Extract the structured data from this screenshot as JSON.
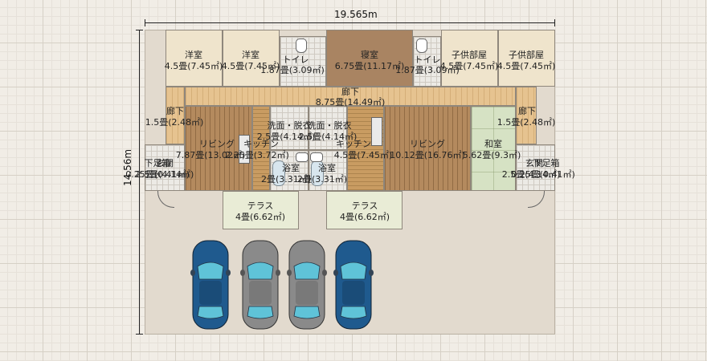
{
  "dimensions": {
    "width_label": "19.565m",
    "height_label": "14.56m"
  },
  "rooms": {
    "western1": {
      "name": "洋室",
      "size": "4.5畳(7.45㎡)"
    },
    "western2": {
      "name": "洋室",
      "size": "4.5畳(7.45㎡)"
    },
    "toilet1": {
      "name": "トイレ",
      "size": "1.87畳(3.09㎡)"
    },
    "bedroom": {
      "name": "寝室",
      "size": "6.75畳(11.17㎡)"
    },
    "toilet2": {
      "name": "トイレ",
      "size": "1.87畳(3.09㎡)"
    },
    "kids1": {
      "name": "子供部屋",
      "size": "4.5畳(7.45㎡)"
    },
    "kids2": {
      "name": "子供部屋",
      "size": "4.5畳(7.45㎡)"
    },
    "corridor_main": {
      "name": "廊下",
      "size": "8.75畳(14.49㎡)"
    },
    "corridor_left": {
      "name": "廊下",
      "size": "1.5畳(2.48㎡)"
    },
    "corridor_right": {
      "name": "廊下",
      "size": "1.5畳(2.48㎡)"
    },
    "wash1": {
      "name": "洗面・脱衣",
      "size": "2.5畳(4.14㎡)"
    },
    "wash2": {
      "name": "洗面・脱衣",
      "size": "2.5畳(4.14㎡)"
    },
    "living1": {
      "name": "リビング",
      "size": "7.87畳(13.02㎡)"
    },
    "kitchen1": {
      "name": "キッチン",
      "size": "2.25畳(3.72㎡)"
    },
    "kitchen2": {
      "name": "キッチン",
      "size": "4.5畳(7.45㎡)"
    },
    "living2": {
      "name": "リビング",
      "size": "10.12畳(16.76㎡)"
    },
    "washitsu": {
      "name": "和室",
      "size": "5.62畳(9.3㎡)"
    },
    "bath1": {
      "name": "浴室",
      "size": "2畳(3.31㎡)"
    },
    "bath2": {
      "name": "浴室",
      "size": "2畳(3.31㎡)"
    },
    "shoebox_left": {
      "name": "下足箱",
      "size": "0.25畳(0.41㎡)"
    },
    "entrance_left": {
      "name": "玄関",
      "size": "2.5畳(4.14㎡)"
    },
    "entrance_right": {
      "name": "玄関",
      "size": "2.5畳(4.14㎡)"
    },
    "shoebox_right": {
      "name": "下足箱",
      "size": "0.25畳(0.41㎡)"
    },
    "terrace1": {
      "name": "テラス",
      "size": "4畳(6.62㎡)"
    },
    "terrace2": {
      "name": "テラス",
      "size": "4畳(6.62㎡)"
    }
  },
  "cars": [
    {
      "color": "#1f5a8e",
      "name": "car-blue-1"
    },
    {
      "color": "#8a8a8a",
      "name": "car-gray-1"
    },
    {
      "color": "#8a8a8a",
      "name": "car-gray-2"
    },
    {
      "color": "#1f5a8e",
      "name": "car-blue-2"
    }
  ],
  "colors": {
    "accent_wood": "#b48a5e",
    "site": "#e2dace"
  }
}
